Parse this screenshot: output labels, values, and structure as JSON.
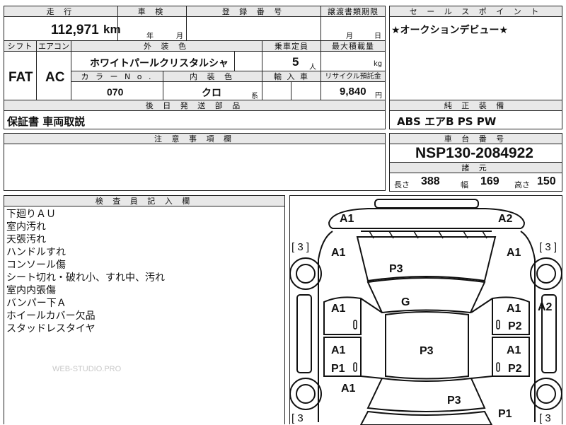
{
  "headers": {
    "mileage": "走 行",
    "inspection": "車 検",
    "registration": "登 録 番 号",
    "transfer_deadline": "譲渡書類期限",
    "sales_point": "セ ー ル ス ポ イ ン ト",
    "shift": "シフト",
    "aircon": "エアコン",
    "exterior_color": "外 装 色",
    "capacity": "乗車定員",
    "max_load": "最大積載量",
    "color_no": "カ ラ ー N o .",
    "interior_color": "内 装 色",
    "import": "輸 入 車",
    "recycle": "リサイクル預託金",
    "later_parts": "後 日 発 送 部 品",
    "standard_equipment": "純 正 装 備",
    "notes": "注 意 事 項 欄",
    "chassis_number": "車 台 番 号",
    "specs": "諸 元",
    "inspector_notes": "検 査 員 記 入 欄"
  },
  "values": {
    "mileage": "112,971",
    "mileage_unit": "km",
    "inspection_year": "年",
    "inspection_month": "月",
    "transfer_month": "月",
    "transfer_day": "日",
    "sales_point": "★オークションデビュー★",
    "shift": "FAT",
    "aircon": "AC",
    "exterior_color": "ホワイトパールクリスタルシャイ",
    "capacity": "5",
    "capacity_unit": "人",
    "max_load_unit": "kg",
    "color_no": "070",
    "interior_color": "クロ",
    "interior_suffix": "系",
    "recycle": "9,840",
    "recycle_unit": "円",
    "later_parts": "保証書 車両取説",
    "standard_equipment": "ABS エアB PS PW",
    "chassis_number": "NSP130-2084922",
    "spec_length_label": "長さ",
    "spec_length": "388",
    "spec_width_label": "幅",
    "spec_width": "169",
    "spec_height_label": "高さ",
    "spec_height": "150"
  },
  "inspector_remarks": [
    "下廻りＡＵ",
    "室内汚れ",
    "天張汚れ",
    "ハンドルすれ",
    "コンソール傷",
    "シート切れ・破れ小、すれ中、汚れ",
    "室内内張傷",
    "バンパー下Ａ",
    "ホイールカバー欠品",
    "スタッドレスタイヤ"
  ],
  "watermark": "WEB-STUDIO.PRO",
  "diagram_marks": {
    "front_left": "A1",
    "front_right": "A2",
    "bracket_left": "[ 3 ]",
    "bracket_right": "[ 3 ]",
    "left_fender": "A1",
    "right_fender": "A1",
    "hood": "P3",
    "windshield": "G",
    "left_front_door": "A1",
    "right_front_door": "A1",
    "right_front_door_p": "P2",
    "right_edge": "A2",
    "roof": "P3",
    "left_rear_door": "A1",
    "left_rear_door_p": "P1",
    "right_rear_door": "A1",
    "right_rear_door_p": "P2",
    "left_quarter": "A1",
    "trunk": "P3",
    "rear_right": "P1",
    "bottom_bracket_left": "[ 3",
    "bottom_bracket_right": "[ 3"
  }
}
